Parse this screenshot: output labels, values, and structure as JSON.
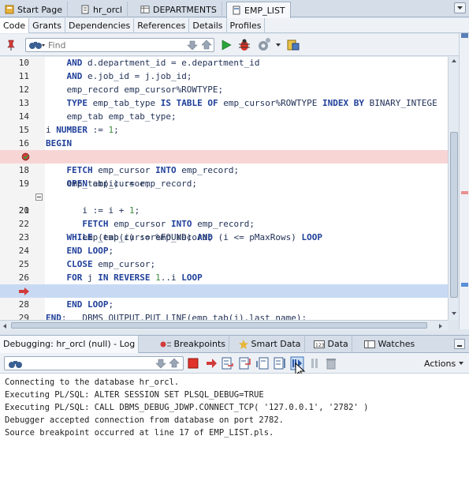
{
  "doc_tabs": [
    {
      "label": "Start Page",
      "icon": "start-page-icon"
    },
    {
      "label": "hr_orcl",
      "icon": "connection-icon"
    },
    {
      "label": "DEPARTMENTS",
      "icon": "table-icon"
    },
    {
      "label": "EMP_LIST",
      "icon": "procedure-icon"
    }
  ],
  "sub_tabs": [
    "Code",
    "Grants",
    "Dependencies",
    "References",
    "Details",
    "Profiles"
  ],
  "editor_toolbar": {
    "find_placeholder": "Find"
  },
  "code_lines": [
    {
      "num": "10",
      "text": "    AND d.department_id = e.department_id"
    },
    {
      "num": "11",
      "text": "    AND e.job_id = j.job_id;"
    },
    {
      "num": "12",
      "text": "    emp_record emp_cursor%ROWTYPE;"
    },
    {
      "num": "13",
      "text": "    TYPE emp_tab_type IS TABLE OF emp_cursor%ROWTYPE INDEX BY BINARY_INTEGE"
    },
    {
      "num": "14",
      "text": "    emp_tab emp_tab_type;"
    },
    {
      "num": "15",
      "text": "i NUMBER := 1;"
    },
    {
      "num": "16",
      "text": "BEGIN"
    },
    {
      "num": "",
      "text": "    OPEN emp_cursor;"
    },
    {
      "num": "18",
      "text": "    FETCH emp_cursor INTO emp_record;"
    },
    {
      "num": "19",
      "text": "    emp_tab(i) := emp_record;"
    },
    {
      "num": "20",
      "text": "    WHILE (emp_cursor%FOUND) AND (i <= pMaxRows) LOOP"
    },
    {
      "num": "21",
      "text": "       i := i + 1;"
    },
    {
      "num": "22",
      "text": "       FETCH emp_cursor INTO emp_record;"
    },
    {
      "num": "23",
      "text": "       emp_tab(i) := emp_record;"
    },
    {
      "num": "24",
      "text": "    END LOOP;"
    },
    {
      "num": "25",
      "text": "    CLOSE emp_cursor;"
    },
    {
      "num": "26",
      "text": "    FOR j IN REVERSE 1..i LOOP"
    },
    {
      "num": "",
      "text": "       DBMS_OUTPUT.PUT_LINE(emp_tab(j).last_name);"
    },
    {
      "num": "28",
      "text": "    END LOOP;"
    },
    {
      "num": "29",
      "text": "END;"
    }
  ],
  "debug_tabs": [
    {
      "label": "Debugging: hr_orcl (null) - Log"
    },
    {
      "label": "Breakpoints"
    },
    {
      "label": "Smart Data"
    },
    {
      "label": "Data"
    },
    {
      "label": "Watches"
    }
  ],
  "debug_toolbar": {
    "actions_label": "Actions"
  },
  "log_lines": [
    "Connecting to the database hr_orcl.",
    "Executing PL/SQL: ALTER SESSION SET PLSQL_DEBUG=TRUE",
    "Executing PL/SQL: CALL DBMS_DEBUG_JDWP.CONNECT_TCP( '127.0.0.1', '2782' )",
    "Debugger accepted connection from database on port 2782.",
    "Source breakpoint occurred at line 17 of EMP_LIST.pls."
  ],
  "colors": {
    "breakpoint_line": "#f7d5d5",
    "current_line": "#c8daf3",
    "keyword": "#20409a"
  }
}
